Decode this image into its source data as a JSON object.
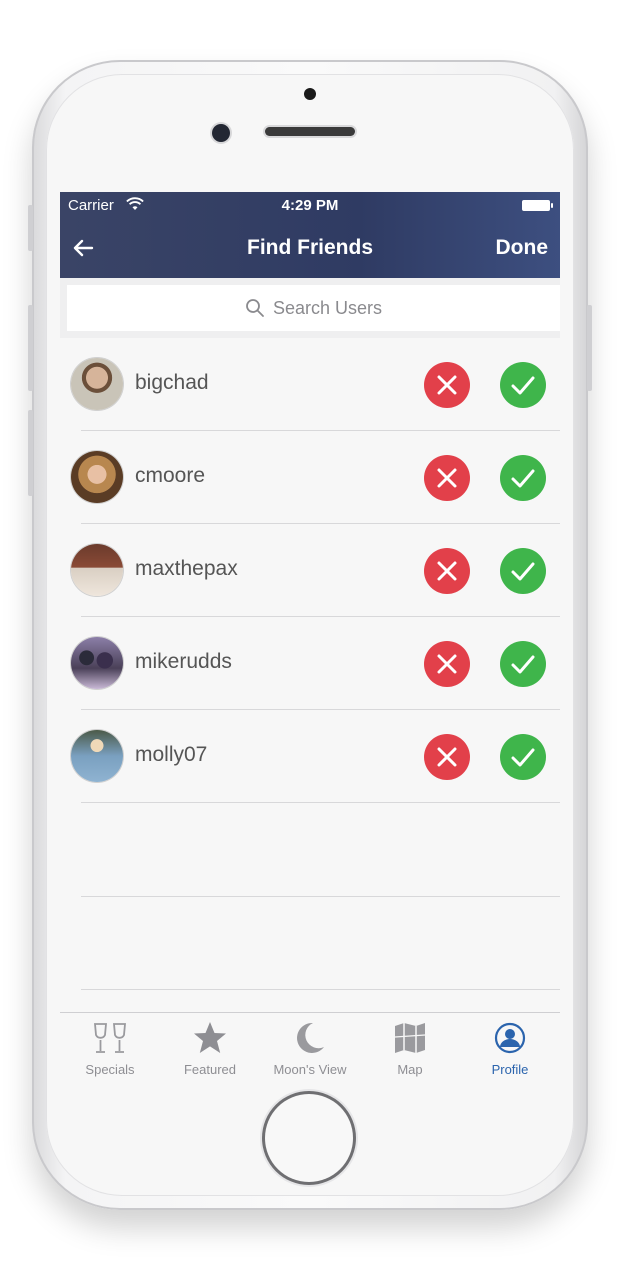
{
  "status_bar": {
    "carrier": "Carrier",
    "time": "4:29 PM"
  },
  "nav": {
    "title": "Find Friends",
    "done_label": "Done"
  },
  "search": {
    "placeholder": "Search Users"
  },
  "friends": [
    {
      "username": "bigchad"
    },
    {
      "username": "cmoore"
    },
    {
      "username": "maxthepax"
    },
    {
      "username": "mikerudds"
    },
    {
      "username": "molly07"
    }
  ],
  "tabs": [
    {
      "label": "Specials",
      "icon": "wine-glasses-icon"
    },
    {
      "label": "Featured",
      "icon": "star-icon"
    },
    {
      "label": "Moon's View",
      "icon": "moon-icon"
    },
    {
      "label": "Map",
      "icon": "map-icon"
    },
    {
      "label": "Profile",
      "icon": "profile-icon",
      "active": true
    }
  ],
  "colors": {
    "nav_bar": "#2f3b63",
    "reject": "#e2404a",
    "accept": "#3fb54b",
    "active_tab": "#2b64ad",
    "inactive_tab": "#8e8e93"
  }
}
